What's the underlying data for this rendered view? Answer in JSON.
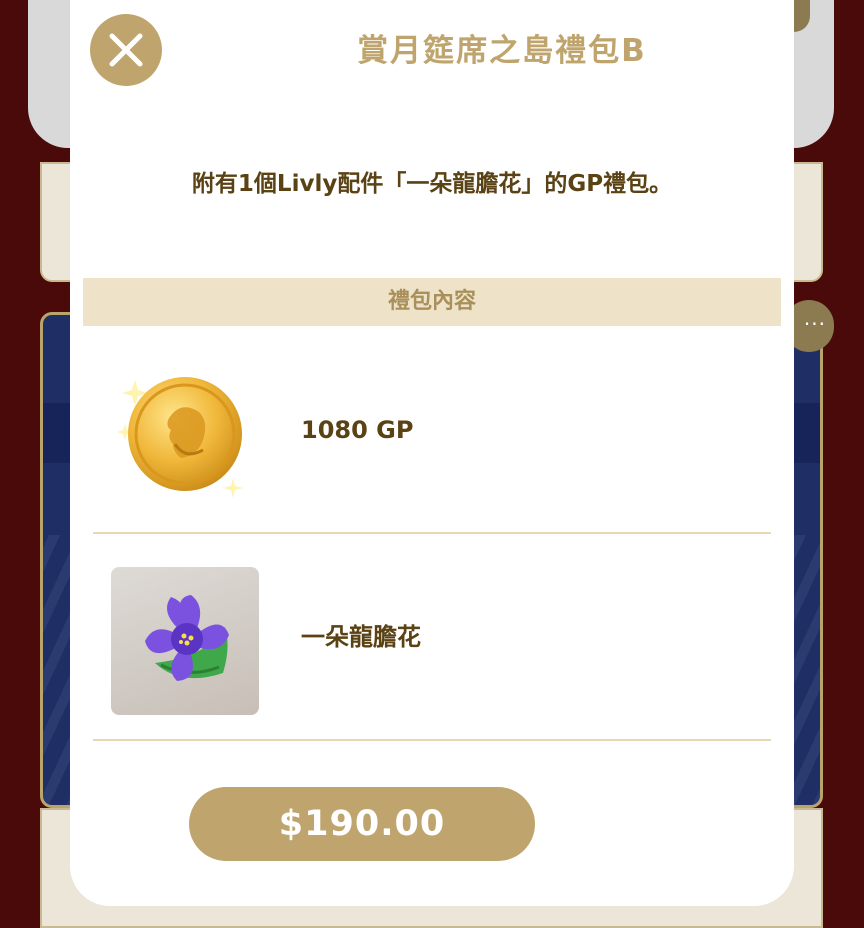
{
  "dialog": {
    "title": "賞月筵席之島禮包B",
    "description": "附有1個Livly配件「一朵龍膽花」的GP禮包。",
    "section_header": "禮包內容",
    "items": [
      {
        "name": "1080 GP",
        "icon": "gold-coin-icon"
      },
      {
        "name": "一朵龍膽花",
        "icon": "gentian-flower-icon"
      }
    ],
    "price_label": "$190.00",
    "close_icon": "close-icon"
  },
  "background": {
    "more_label": "···"
  },
  "colors": {
    "accent": "#bfa56d",
    "text_dark": "#5a4214",
    "section_bg": "#eee2c9",
    "backdrop": "#4a0a0a"
  }
}
